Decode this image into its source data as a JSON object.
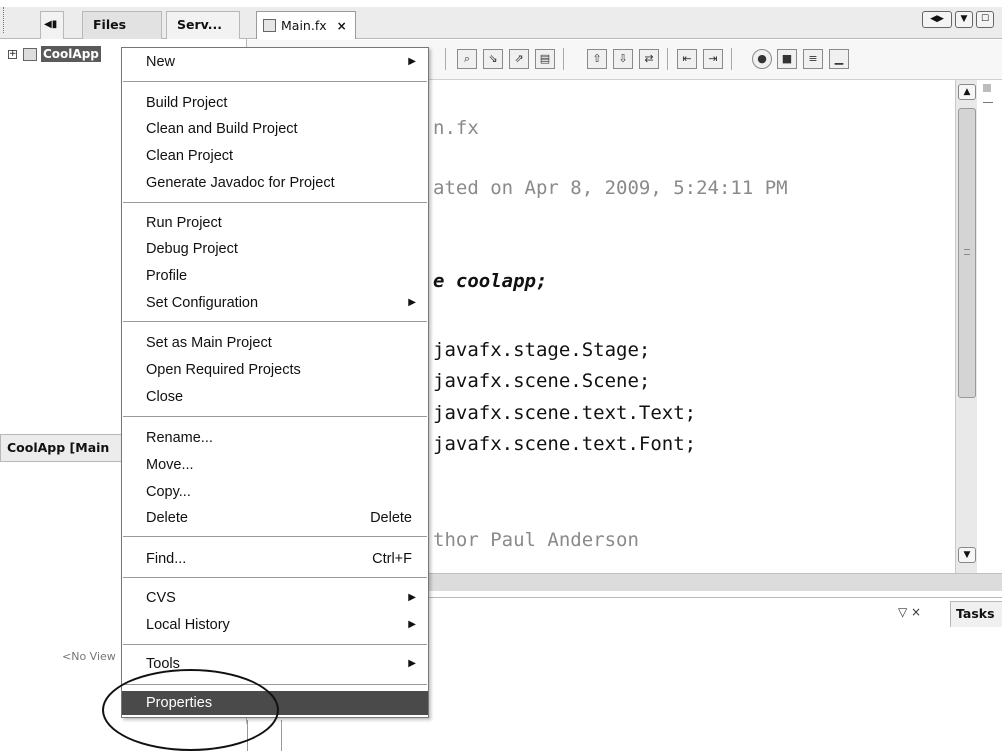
{
  "left_tabs": [
    {
      "label": "Files"
    },
    {
      "label": "Serv..."
    }
  ],
  "left_tab_controls": "◀▮ ×",
  "project_tree": {
    "root_label": "CoolApp"
  },
  "navigator": {
    "title": "CoolApp [Main",
    "empty_text": "<No View"
  },
  "editor": {
    "tab_label": "Main.fx",
    "tab_close": "×",
    "code_lines": [
      {
        "text": "n.fx",
        "style": "gray"
      },
      {
        "text": "ated on Apr 8, 2009, 5:24:11 PM",
        "style": "gray"
      },
      {
        "text": "e coolapp;",
        "style": "keyword"
      },
      {
        "text": "javafx.stage.Stage;",
        "style": "normal"
      },
      {
        "text": "javafx.scene.Scene;",
        "style": "normal"
      },
      {
        "text": "javafx.scene.text.Text;",
        "style": "normal"
      },
      {
        "text": "javafx.scene.text.Font;",
        "style": "normal"
      },
      {
        "text": "thor Paul Anderson",
        "style": "gray"
      }
    ]
  },
  "output": {
    "tasks_tab": "Tasks",
    "controls": "▽ ×"
  },
  "context_menu": {
    "items": [
      {
        "label": "New",
        "submenu": true
      },
      {
        "label": "Build Project"
      },
      {
        "label": "Clean and Build Project"
      },
      {
        "label": "Clean Project"
      },
      {
        "label": "Generate Javadoc for Project"
      },
      {
        "label": "Run Project"
      },
      {
        "label": "Debug Project"
      },
      {
        "label": "Profile"
      },
      {
        "label": "Set Configuration",
        "submenu": true
      },
      {
        "label": "Set as Main Project"
      },
      {
        "label": "Open Required Projects"
      },
      {
        "label": "Close"
      },
      {
        "label": "Rename..."
      },
      {
        "label": "Move..."
      },
      {
        "label": "Copy..."
      },
      {
        "label": "Delete",
        "shortcut": "Delete"
      },
      {
        "label": "Find...",
        "shortcut": "Ctrl+F"
      },
      {
        "label": "CVS",
        "submenu": true
      },
      {
        "label": "Local History",
        "submenu": true
      },
      {
        "label": "Tools",
        "submenu": true
      },
      {
        "label": "Properties",
        "selected": true
      }
    ]
  },
  "icons": {
    "submenu_arrow": "▶",
    "scroll_up": "▲",
    "scroll_down": "▼",
    "nav_left": "◀",
    "nav_right": "▶",
    "dropdown": "▼",
    "maximize": "☐"
  },
  "colors": {
    "menu_selected_bg": "#4a4a4a",
    "project_label_bg": "#5a5a5a"
  }
}
